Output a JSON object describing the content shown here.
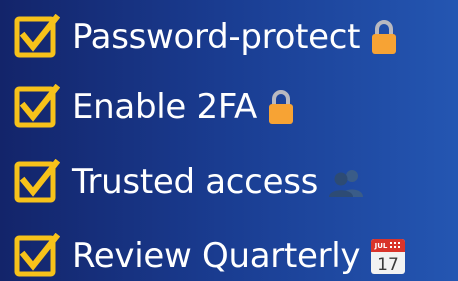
{
  "colors": {
    "background_start": "#13246a",
    "background_end": "#2456b2",
    "checkbox": "#f7c21a",
    "text": "#ffffff",
    "lock": "#f7a334",
    "people": "#2d4b74",
    "calendar_header": "#d9342b"
  },
  "items": [
    {
      "label": "Password-protect",
      "checked": true,
      "icon": "lock-icon"
    },
    {
      "label": "Enable 2FA",
      "checked": true,
      "icon": "lock-icon"
    },
    {
      "label": "Trusted access",
      "checked": true,
      "icon": "people-icon"
    },
    {
      "label": "Review Quarterly",
      "checked": true,
      "icon": "calendar-icon"
    }
  ],
  "calendar": {
    "month": "JUL",
    "day": "17"
  }
}
